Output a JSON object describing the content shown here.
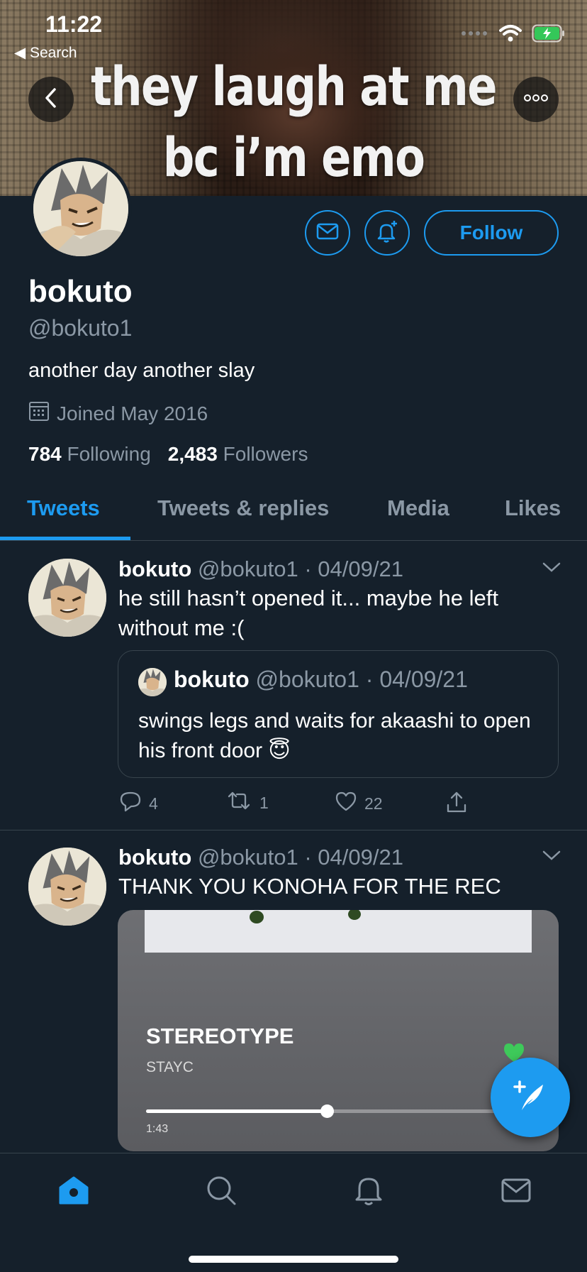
{
  "status_bar": {
    "time": "11:22",
    "back_label": "◀ Search"
  },
  "banner": {
    "caption_line1": "they laugh at me",
    "caption_line2": "bc i’m emo"
  },
  "profile": {
    "name": "bokuto",
    "handle": "@bokuto1",
    "bio": "another day another slay",
    "joined": "Joined May 2016",
    "following_count": "784",
    "following_label": "Following",
    "followers_count": "2,483",
    "followers_label": "Followers",
    "follow_button": "Follow"
  },
  "tabs": [
    {
      "label": "Tweets",
      "active": true
    },
    {
      "label": "Tweets & replies",
      "active": false
    },
    {
      "label": "Media",
      "active": false
    },
    {
      "label": "Likes",
      "active": false
    }
  ],
  "tweets": [
    {
      "name": "bokuto",
      "handle_date": "@bokuto1 · 04/09/21",
      "text": "he still hasn’t opened it... maybe he left without me :(",
      "quote": {
        "name": "bokuto",
        "handle_date": "@bokuto1 · 04/09/21",
        "text": "swings legs and waits for akaashi to open his front door 😇"
      },
      "replies": "4",
      "retweets": "1",
      "likes": "22"
    },
    {
      "name": "bokuto",
      "handle_date": "@bokuto1 · 04/09/21",
      "text": "THANK YOU KONOHA FOR THE REC",
      "media": {
        "song_title": "STEREOTYPE",
        "artist": "STAYC",
        "elapsed": "1:43",
        "progress": 0.49
      }
    }
  ],
  "colors": {
    "background": "#15202b",
    "accent": "#1d9bf0",
    "secondary_text": "#8b98a5",
    "divider": "#38444d"
  },
  "icons": {
    "nav": [
      "home-icon",
      "search-icon",
      "bell-icon",
      "mail-icon"
    ],
    "fab": "compose-icon"
  }
}
